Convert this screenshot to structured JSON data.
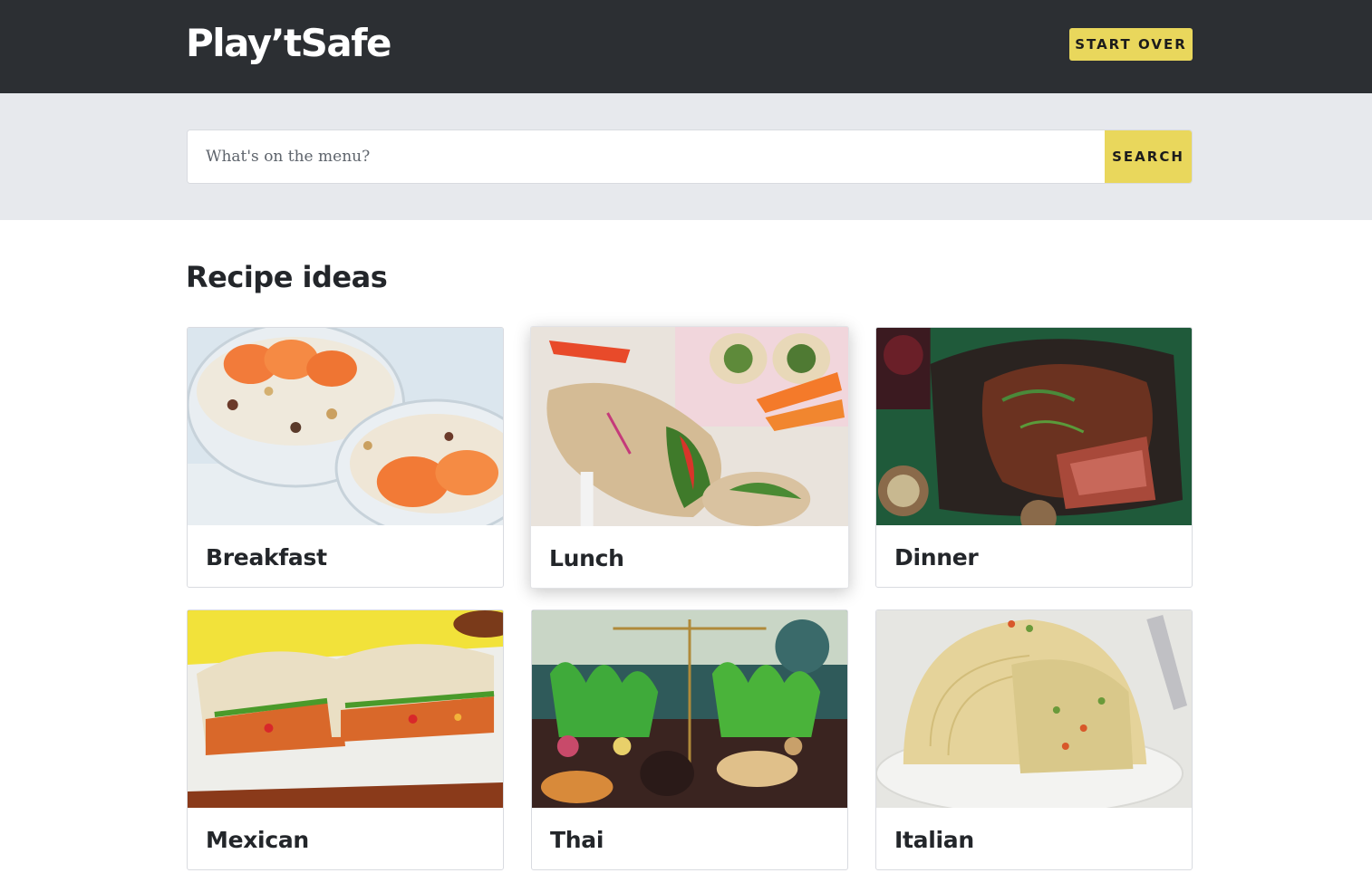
{
  "header": {
    "logo_text": "Play’tSafe",
    "start_over_label": "START OVER"
  },
  "search": {
    "placeholder": "What's on the menu?",
    "value": "",
    "button_label": "SEARCH"
  },
  "main": {
    "section_title": "Recipe ideas",
    "cards": [
      {
        "label": "Breakfast"
      },
      {
        "label": "Lunch"
      },
      {
        "label": "Dinner"
      },
      {
        "label": "Mexican"
      },
      {
        "label": "Thai"
      },
      {
        "label": "Italian"
      }
    ]
  },
  "colors": {
    "header_bg": "#2c2f33",
    "accent_yellow": "#e9d75c",
    "search_band_bg": "#e7e9ed"
  }
}
